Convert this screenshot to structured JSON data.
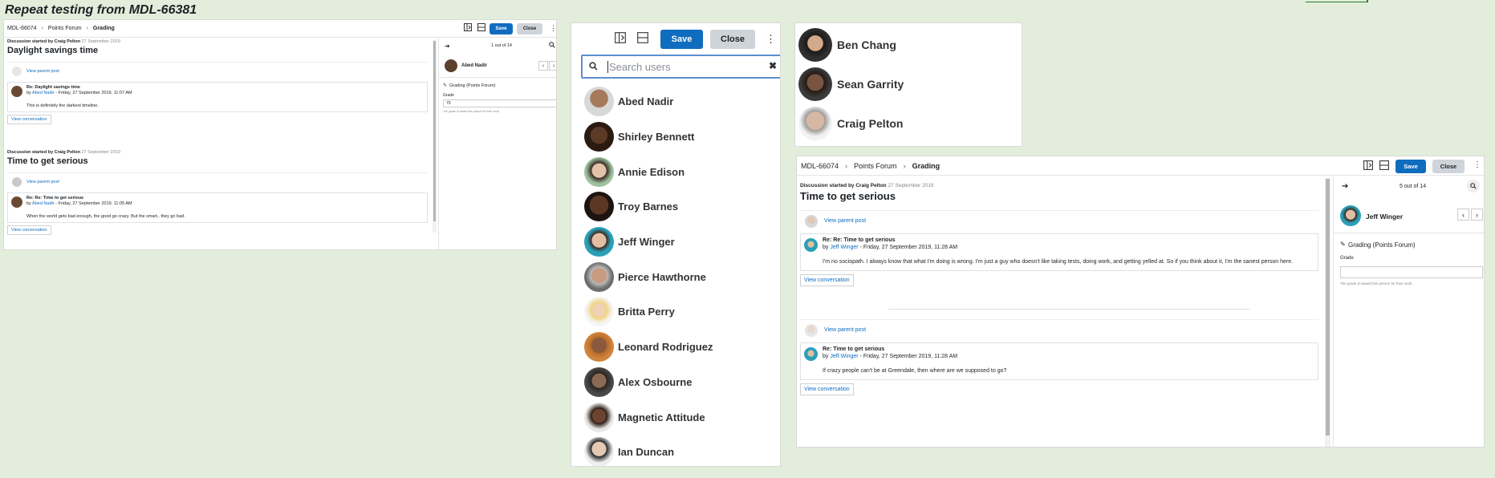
{
  "caption": "Repeat testing from MDL-66381",
  "icons": {
    "layout_a": "collapse-left-icon",
    "layout_b": "collapse-center-icon",
    "kebab": "kebab-icon",
    "arrow": "arrow-right-icon",
    "search": "search-icon",
    "prev": "chevron-left-icon",
    "next": "chevron-right-icon",
    "pencil": "pencil-icon",
    "clear": "close-icon"
  },
  "colors": {
    "primary": "#0f6cbf",
    "secondary": "#ced4da",
    "background": "#e2eedb"
  },
  "panel1": {
    "breadcrumb": [
      "MDL-66074",
      "Points Forum",
      "Grading"
    ],
    "save": "Save",
    "close": "Close",
    "discussions": [
      {
        "started_label": "Discussion started by Craig Pelton",
        "date": "27 September 2019",
        "title": "Daylight savings time",
        "parent_link": "View parent post",
        "post_title": "Re: Daylight savings time",
        "by": "by",
        "author": "Abed Nadir",
        "post_date": "- Friday, 27 September 2019, 11:07 AM",
        "body": "This is definitely the darkest timeline.",
        "view_conversation": "View conversation"
      },
      {
        "started_label": "Discussion started by Craig Pelton",
        "date": "27 September 2019",
        "title": "Time to get serious",
        "parent_link": "View parent post",
        "post_title": "Re: Re: Time to get serious",
        "by": "by",
        "author": "Abed Nadir",
        "post_date": "- Friday, 27 September 2019, 11:05 AM",
        "body": "When the world gets bad enough, the good go crazy. But the smart.. they go bad.",
        "view_conversation": "View conversation"
      }
    ],
    "sidebar": {
      "count": "1 out of 14",
      "user": "Abed Nadir",
      "grading_label": "Grading (Points Forum)",
      "grade_label": "Grade",
      "grade_value": "70",
      "grade_help": "The grade to award this person for their work."
    }
  },
  "panel2": {
    "save": "Save",
    "close": "Close",
    "search_placeholder": "Search users",
    "users": [
      "Abed Nadir",
      "Shirley Bennett",
      "Annie Edison",
      "Troy Barnes",
      "Jeff Winger",
      "Pierce Hawthorne",
      "Britta Perry",
      "Leonard Rodriguez",
      "Alex Osbourne",
      "Magnetic Attitude",
      "Ian Duncan"
    ]
  },
  "panel3": {
    "users": [
      "Ben Chang",
      "Sean Garrity",
      "Craig Pelton"
    ]
  },
  "panel4": {
    "breadcrumb": [
      "MDL-66074",
      "Points Forum",
      "Grading"
    ],
    "save": "Save",
    "close": "Close",
    "started_label": "Discussion started by Craig Pelton",
    "date": "27 September 2019",
    "title": "Time to get serious",
    "posts": [
      {
        "parent_link": "View parent post",
        "post_title": "Re: Re: Time to get serious",
        "by": "by",
        "author": "Jeff Winger",
        "post_date": "- Friday, 27 September 2019, 11:28 AM",
        "body": "I'm no sociopath. I always know that what I'm doing is wrong. I'm just a guy who doesn't like taking tests, doing work, and getting yelled at. So if you think about it, I'm the sanest person here.",
        "view_conversation": "View conversation"
      },
      {
        "parent_link": "View parent post",
        "post_title": "Re: Time to get serious",
        "by": "by",
        "author": "Jeff Winger",
        "post_date": "- Friday, 27 September 2019, 11:28 AM",
        "body": "If crazy people can't be at Greendale, then where are we supposed to go?",
        "view_conversation": "View conversation"
      }
    ],
    "sidebar": {
      "count": "5 out of 14",
      "user": "Jeff Winger",
      "grading_label": "Grading (Points Forum)",
      "grade_label": "Grade",
      "grade_value": "",
      "grade_help": "The grade to award this person for their work."
    }
  }
}
